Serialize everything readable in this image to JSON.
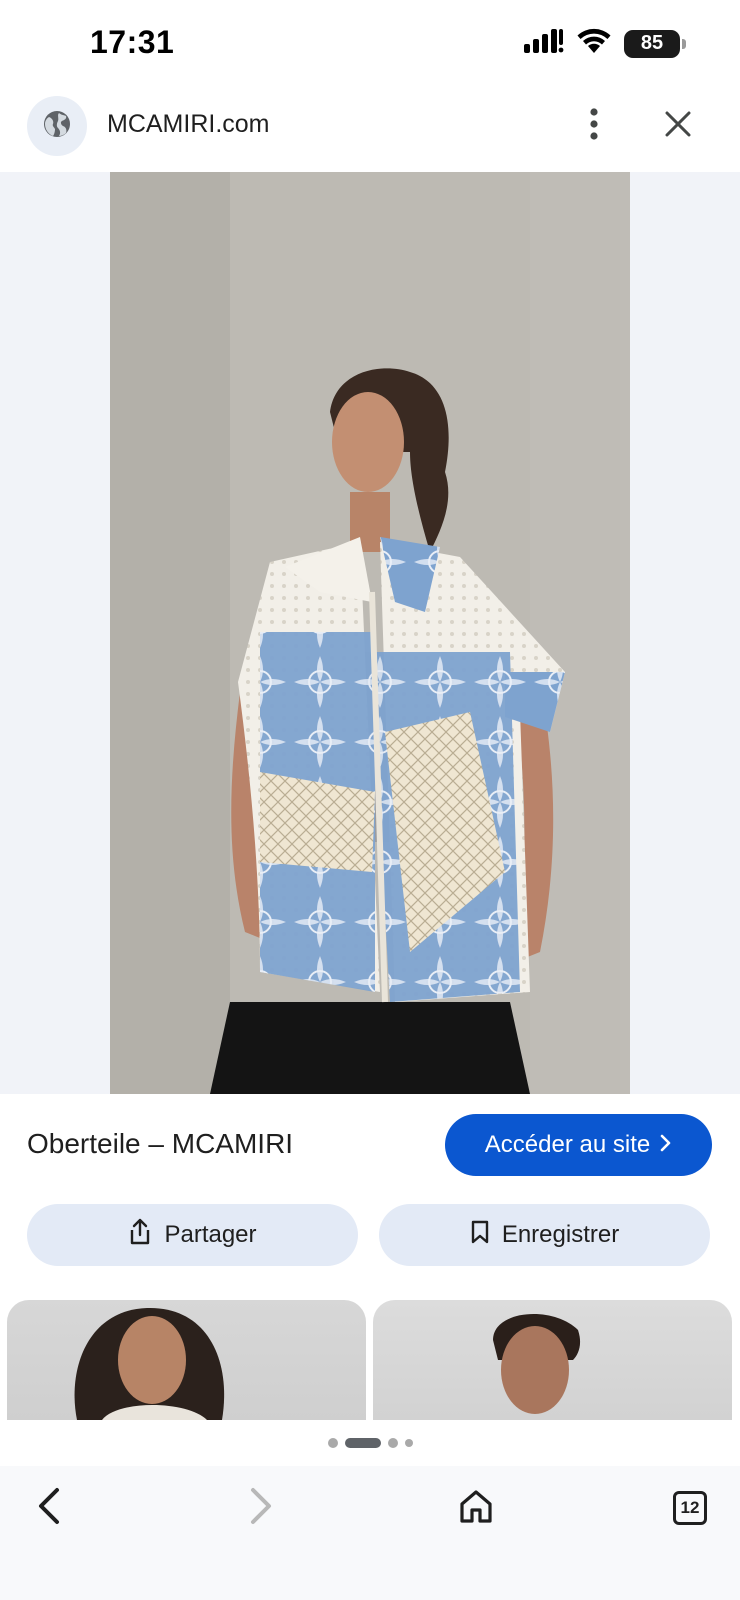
{
  "status_bar": {
    "time": "17:31",
    "battery": "85",
    "icons": [
      "signal-icon",
      "wifi-icon",
      "battery-icon"
    ]
  },
  "header": {
    "site_title": "MCAMIRI.com",
    "icons": [
      "globe-icon",
      "more-vert-icon",
      "close-icon"
    ]
  },
  "result": {
    "title": "Oberteile – MCAMIRI",
    "visit_label": "Accéder au site",
    "share_label": "Partager",
    "save_label": "Enregistrer"
  },
  "pager": {
    "count": 4,
    "active_index": 1
  },
  "bottom_nav": {
    "tab_count": "12",
    "icons": [
      "back-arrow-icon",
      "forward-arrow-icon",
      "home-icon",
      "tabs-icon"
    ]
  },
  "colors": {
    "accent": "#0b57d0",
    "button_tint": "#e3eaf6",
    "image_backdrop": "#f1f3f8"
  }
}
